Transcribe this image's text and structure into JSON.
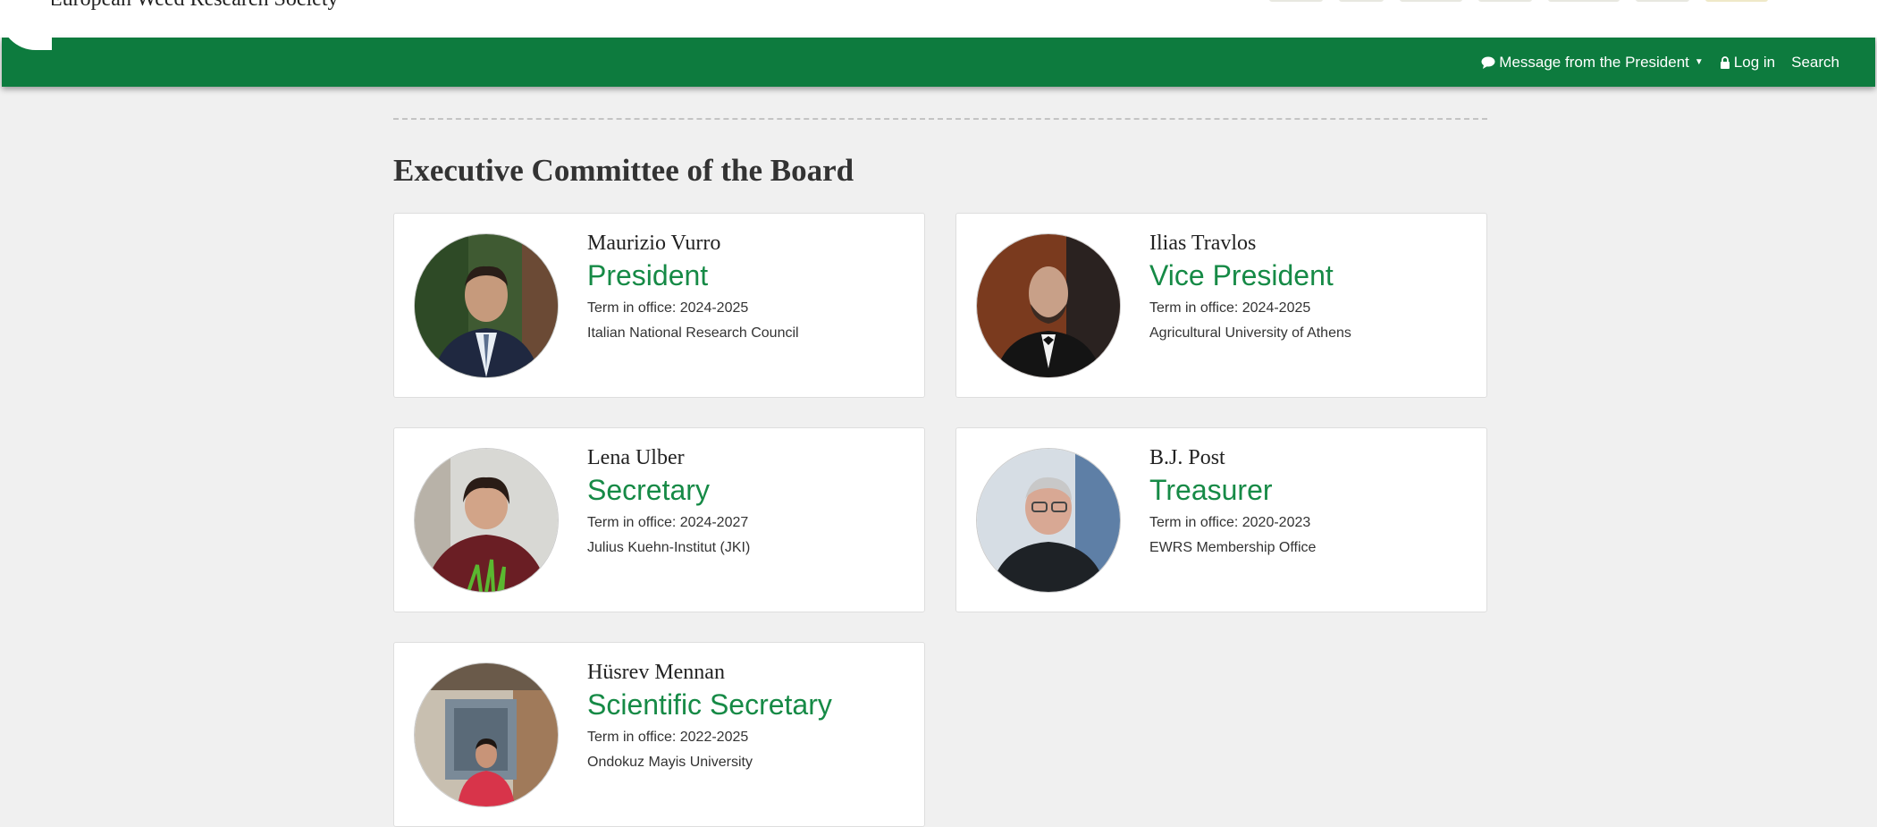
{
  "site": {
    "name": "European Weed Research Society"
  },
  "navbar": {
    "message_label": "Message from the President",
    "login_label": "Log in",
    "search_label": "Search",
    "bg_color": "#0d7b3e"
  },
  "page": {
    "section_title": "Executive Committee of the Board",
    "accent_color": "#168a46"
  },
  "members": [
    {
      "name": "Maurizio Vurro",
      "role": "President",
      "term": "Term in office: 2024-2025",
      "org": "Italian National Research Council"
    },
    {
      "name": "Ilias Travlos",
      "role": "Vice President",
      "term": "Term in office: 2024-2025",
      "org": "Agricultural University of Athens"
    },
    {
      "name": "Lena Ulber",
      "role": "Secretary",
      "term": "Term in office: 2024-2027",
      "org": "Julius Kuehn-Institut (JKI)"
    },
    {
      "name": "B.J. Post",
      "role": "Treasurer",
      "term": "Term in office: 2020-2023",
      "org": "EWRS Membership Office"
    },
    {
      "name": "Hüsrev Mennan",
      "role": "Scientific Secretary",
      "term": "Term in office: 2022-2025",
      "org": "Ondokuz Mayis University"
    }
  ]
}
